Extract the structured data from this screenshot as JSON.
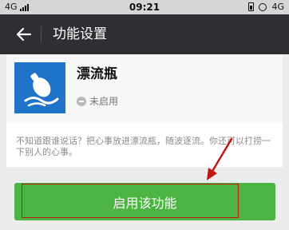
{
  "status_bar": {
    "network_left": "4G",
    "time": "09:21",
    "network_right": "4G"
  },
  "header": {
    "title": "功能设置",
    "back_icon": "arrow-left-icon"
  },
  "plugin": {
    "name": "漂流瓶",
    "status": "未启用",
    "logo_icon": "drift-bottle-logo",
    "logo_color": "#1f73c9"
  },
  "description": "不知道跟谁说话？把心事放进漂流瓶，随波逐流。你还可以打捞一下别人的心事。",
  "action": {
    "enable_label": "启用该功能",
    "button_color": "#4db342"
  },
  "annotation": {
    "color": "#c51616"
  }
}
